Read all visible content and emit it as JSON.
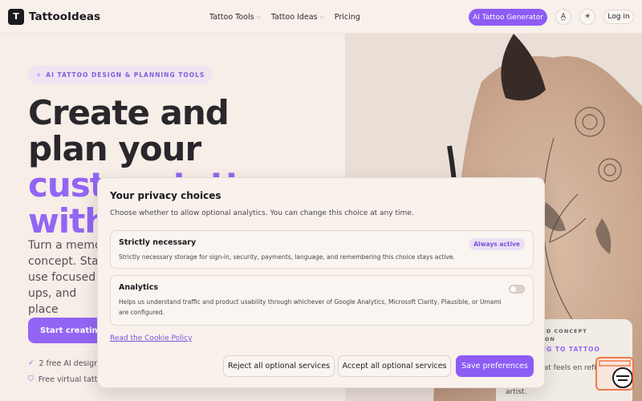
{
  "header": {
    "logo_letter": "T",
    "brand": "TattooIdeas",
    "nav": [
      {
        "label": "Tattoo Tools",
        "dropdown": true
      },
      {
        "label": "Tattoo Ideas",
        "dropdown": true
      },
      {
        "label": "Pricing",
        "dropdown": false
      }
    ],
    "cta_label": "AI Tattoo Generator",
    "translate_icon": "translate-icon",
    "theme_icon": "sun-icon",
    "login_label": "Log in"
  },
  "hero": {
    "badge": "AI TATTOO DESIGN & PLANNING TOOLS",
    "headline_line1": "Create and",
    "headline_line2": "plan your",
    "headline_line3": "custom tattoo",
    "headline_line4": "with",
    "subtext": "Turn a memor concept. Start use focused t ups, and place",
    "cta_label": "Start creating",
    "features": [
      "2 free AI designs",
      "Free virtual tatto"
    ]
  },
  "concept_card": {
    "kicker": "TED CONCEPT",
    "kicker2": "TION",
    "title": "ING TO TATTOO",
    "body": "position that feels en refine it with yo",
    "body2": "artist."
  },
  "privacy_modal": {
    "title": "Your privacy choices",
    "description": "Choose whether to allow optional analytics. You can change this choice at any time.",
    "strict": {
      "title": "Strictly necessary",
      "description": "Strictly necessary storage for sign-in, security, payments, language, and remembering this choice stays active.",
      "badge": "Always active"
    },
    "analytics": {
      "title": "Analytics",
      "description": "Helps us understand traffic and product usability through whichever of Google Analytics, Microsoft Clarity, Plausible, or Umami are configured.",
      "enabled": false
    },
    "policy_link": "Read the Cookie Policy",
    "reject_label": "Reject all optional services",
    "accept_label": "Accept all optional services",
    "save_label": "Save preferences"
  },
  "colors": {
    "accent": "#8d5cf5",
    "background": "#f6ede6"
  }
}
